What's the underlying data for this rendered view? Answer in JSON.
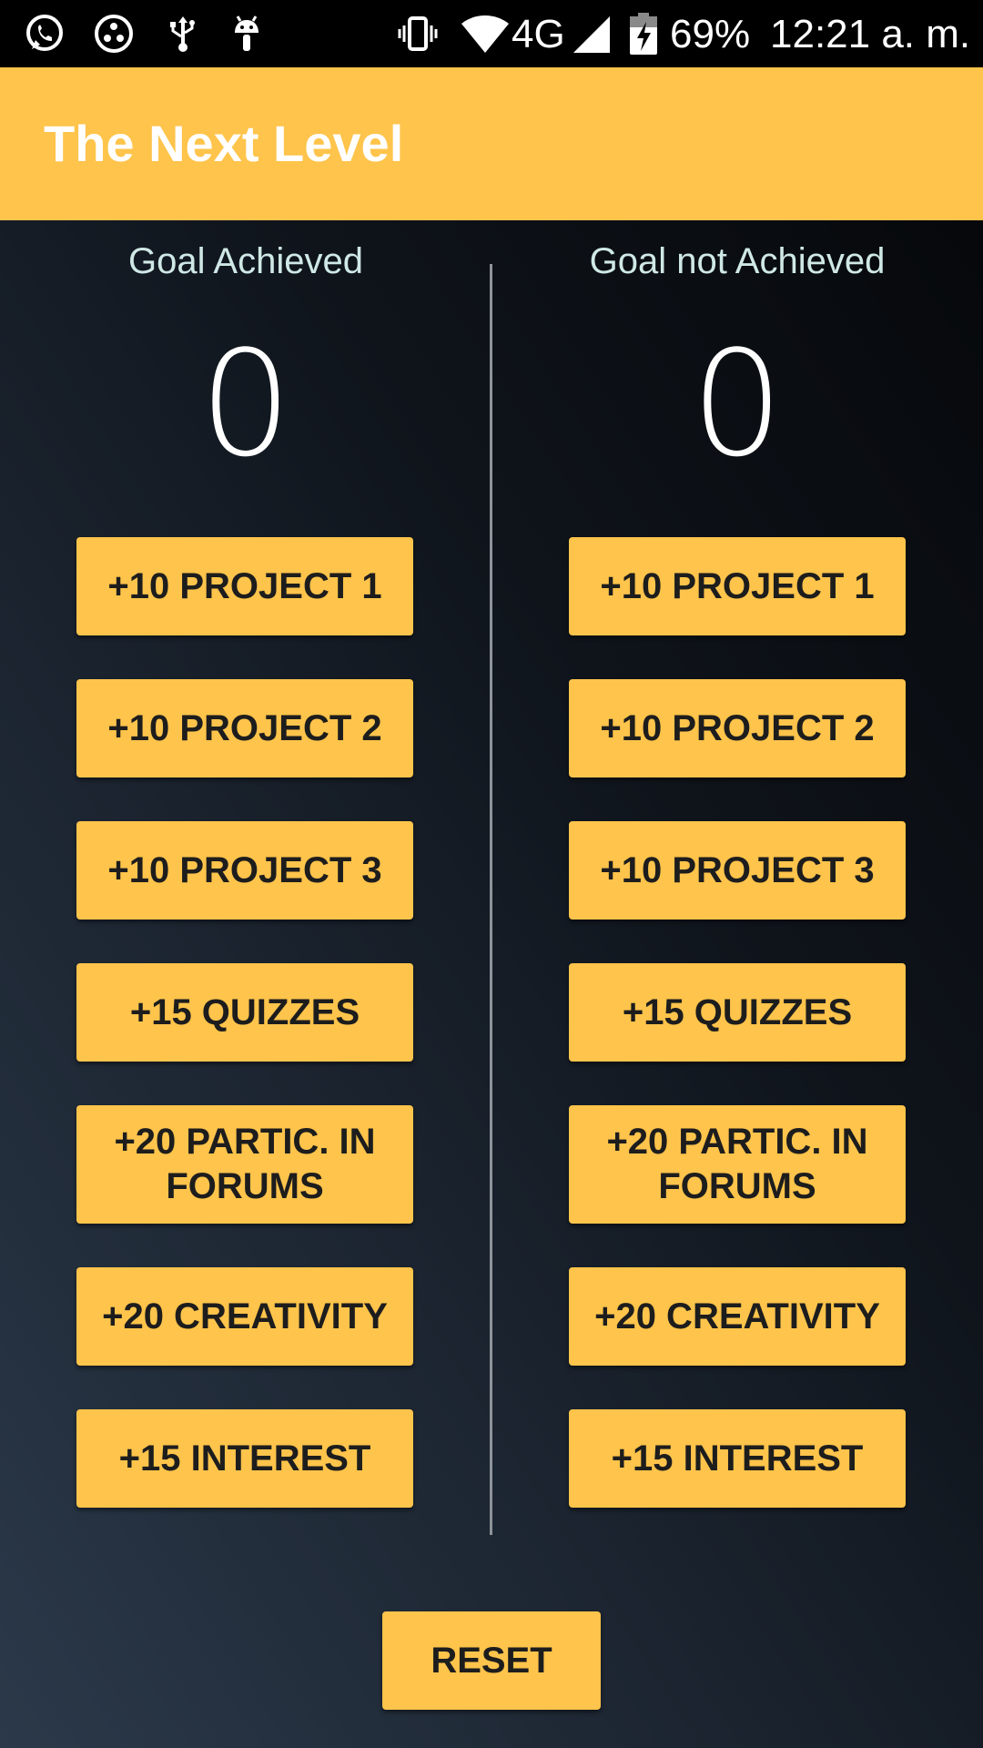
{
  "status_bar": {
    "network": "4G",
    "battery": "69%",
    "time": "12:21 a. m.",
    "icons": [
      "whatsapp-icon",
      "app-icon",
      "usb-icon",
      "android-debug-icon",
      "vibrate-icon",
      "wifi-icon",
      "signal-icon",
      "battery-charging-icon"
    ]
  },
  "app_bar": {
    "title": "The Next Level"
  },
  "columns": [
    {
      "heading": "Goal Achieved",
      "score": "0",
      "buttons": [
        "+10 PROJECT 1",
        "+10 PROJECT 2",
        "+10 PROJECT 3",
        "+15 QUIZZES",
        "+20 PARTIC. IN FORUMS",
        "+20 CREATIVITY",
        "+15 INTEREST"
      ]
    },
    {
      "heading": "Goal not Achieved",
      "score": "0",
      "buttons": [
        "+10 PROJECT 1",
        "+10 PROJECT 2",
        "+10 PROJECT 3",
        "+15 QUIZZES",
        "+20 PARTIC. IN FORUMS",
        "+20 CREATIVITY",
        "+15 INTEREST"
      ]
    }
  ],
  "reset_label": "RESET",
  "colors": {
    "accent": "#fec44b",
    "heading_text": "#cfe8e6",
    "button_text": "#1d1d1d"
  }
}
